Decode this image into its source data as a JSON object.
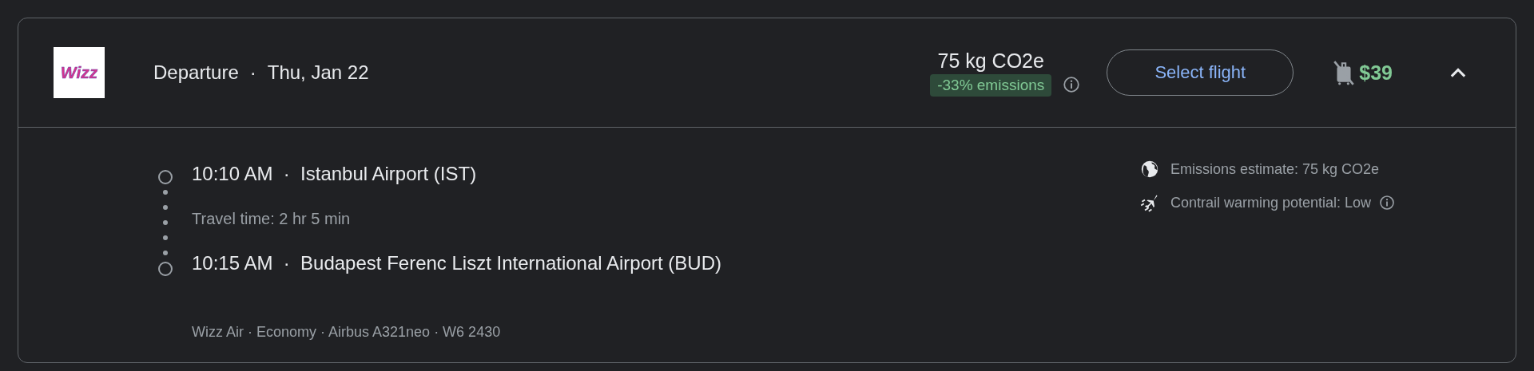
{
  "flight": {
    "logo_text": "Wizz",
    "title": "Departure",
    "separator": "·",
    "date": "Thu, Jan 22",
    "emissions": "75 kg CO2e",
    "emissions_badge": "-33% emissions",
    "action": "Select flight",
    "price": "$39",
    "carry_on_included": false,
    "expanded": true
  },
  "itinerary": {
    "stops": [
      "10:10 AM  ·  Istanbul Airport (IST)",
      "10:15 AM  ·  Budapest Ferenc Liszt International Airport (BUD)"
    ],
    "travel_time": "Travel time: 2 hr 5 min",
    "details": "Wizz Air · Economy · Airbus A321neo · W6 2430"
  },
  "info": [
    {
      "kind": "globe",
      "text": "Emissions estimate: 75 kg CO2e",
      "info_icon": false
    },
    {
      "kind": "contrail",
      "text": "Contrail warming potential: Low",
      "info_icon": true
    }
  ]
}
